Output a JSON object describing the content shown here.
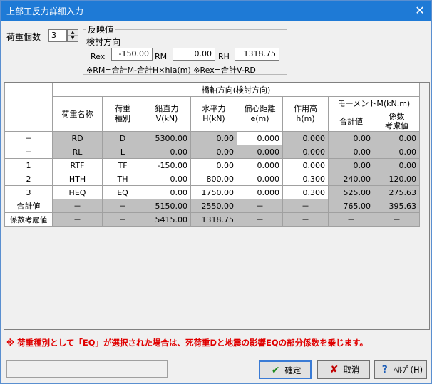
{
  "window": {
    "title": "上部工反力詳細入力",
    "close_glyph": "✕"
  },
  "load_count": {
    "label": "荷重個数",
    "value": "3",
    "up_glyph": "▲",
    "down_glyph": "▼"
  },
  "reflect": {
    "group_label": "反映値",
    "sub_label": "検討方向",
    "rex_label": "Rex",
    "rex_value": "-150.00",
    "rm_label": "RM",
    "rm_value": "0.00",
    "rh_label": "RH",
    "rh_value": "1318.75",
    "formula": "※RM=合計M-合計H×hIa(m) ※Rex=合計V-RD"
  },
  "grid": {
    "group_header": "橋軸方向(検討方向)",
    "moment_header": "モーメントM(kN.m)",
    "headers": {
      "name": "荷重名称",
      "type": "荷重\n種別",
      "v": "鉛直力\nV(kN)",
      "h": "水平力\nH(kN)",
      "e": "偏心距離\ne(m)",
      "hh": "作用高\nh(m)",
      "msum": "合計値",
      "mcoef": "係数\n考慮値"
    },
    "rows": [
      {
        "idx": "－",
        "name": "RD",
        "type": "D",
        "v": "5300.00",
        "h": "0.00",
        "e": "0.000",
        "hh": "0.000",
        "msum": "0.00",
        "mcoef": "0.00"
      },
      {
        "idx": "－",
        "name": "RL",
        "type": "L",
        "v": "0.00",
        "h": "0.00",
        "e": "0.000",
        "hh": "0.000",
        "msum": "0.00",
        "mcoef": "0.00"
      },
      {
        "idx": "1",
        "name": "RTF",
        "type": "TF",
        "v": "-150.00",
        "h": "0.00",
        "e": "0.000",
        "hh": "0.000",
        "msum": "0.00",
        "mcoef": "0.00"
      },
      {
        "idx": "2",
        "name": "HTH",
        "type": "TH",
        "v": "0.00",
        "h": "800.00",
        "e": "0.000",
        "hh": "0.300",
        "msum": "240.00",
        "mcoef": "120.00"
      },
      {
        "idx": "3",
        "name": "HEQ",
        "type": "EQ",
        "v": "0.00",
        "h": "1750.00",
        "e": "0.000",
        "hh": "0.300",
        "msum": "525.00",
        "mcoef": "275.63"
      },
      {
        "idx": "合計値",
        "name": "－",
        "type": "－",
        "v": "5150.00",
        "h": "2550.00",
        "e": "－",
        "hh": "－",
        "msum": "765.00",
        "mcoef": "395.63"
      },
      {
        "idx": "係数考慮値",
        "name": "－",
        "type": "－",
        "v": "5415.00",
        "h": "1318.75",
        "e": "－",
        "hh": "－",
        "msum": "－",
        "mcoef": "－"
      }
    ]
  },
  "note": "※ 荷重種別として「EQ」が選択された場合は、死荷重Dと地震の影響EQの部分係数を乗じます。",
  "buttons": {
    "ok": "確定",
    "ok_icon": "✔",
    "cancel": "取消",
    "cancel_icon": "✘",
    "help": "ﾍﾙﾌﾟ(H)",
    "help_icon": "?"
  }
}
